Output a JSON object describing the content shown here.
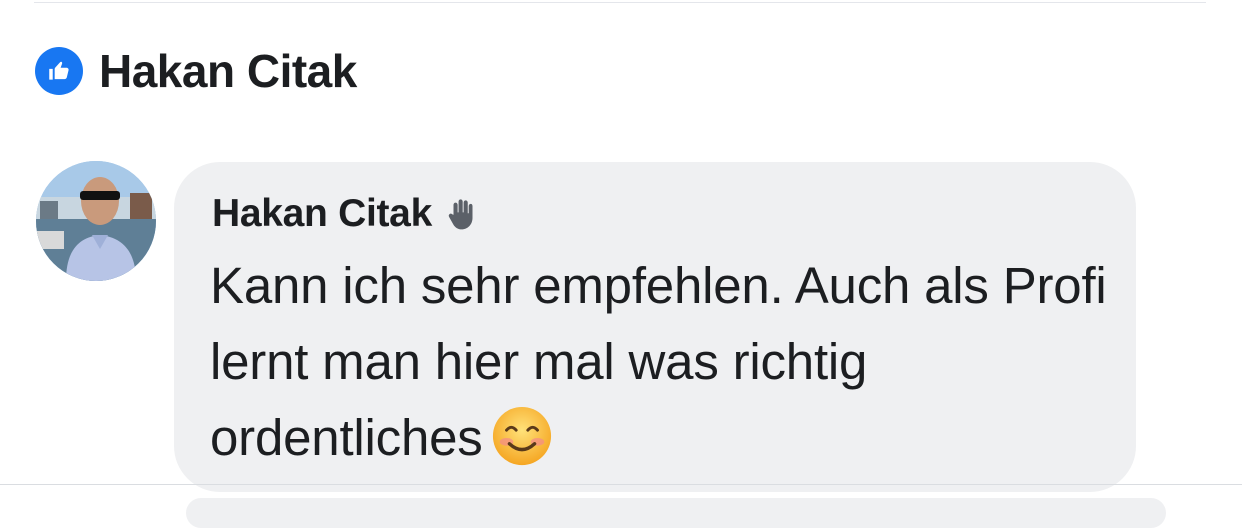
{
  "reaction": {
    "icon": "like-thumbs-up-icon",
    "color": "#1877f2",
    "name": "Hakan Citak"
  },
  "comment": {
    "author": "Hakan Citak",
    "author_badge_icon": "waving-hand-icon",
    "text": "Kann ich sehr empfehlen. Auch als Profi lernt man hier mal was richtig ordentliches",
    "emoji": "smiling-face-icon",
    "bubble_color": "#eff0f2"
  }
}
